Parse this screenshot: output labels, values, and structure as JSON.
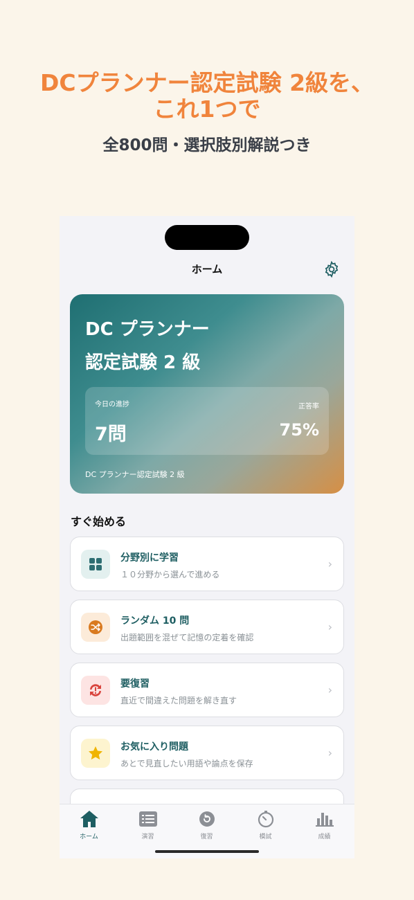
{
  "promo": {
    "headline_line1": "DCプランナー認定試験 2級を、",
    "headline_line2": "これ1つで",
    "subheadline": "全800問・選択肢別解説つき"
  },
  "nav": {
    "title": "ホーム",
    "settings_icon": "gear-icon"
  },
  "hero": {
    "title_line1": "DC プランナー",
    "title_line2": "認定試験 2 級",
    "progress_label": "今日の進捗",
    "progress_value": "7問",
    "accuracy_label": "正答率",
    "accuracy_value": "75%",
    "footer": "DC プランナー認定試験 2 級"
  },
  "section": {
    "title": "すぐ始める"
  },
  "cards": [
    {
      "title": "分野別に学習",
      "subtitle": "１０分野から選んで進める",
      "icon": "grid-icon",
      "icon_bg": "#e3f0ef",
      "icon_color": "#2e6e72"
    },
    {
      "title": "ランダム 10 問",
      "subtitle": "出題範囲を混ぜて記憶の定着を確認",
      "icon": "shuffle-icon",
      "icon_bg": "#fcebd9",
      "icon_color": "#d97a1f"
    },
    {
      "title": "要復習",
      "subtitle": "直近で間違えた問題を解き直す",
      "icon": "review-alert-icon",
      "icon_bg": "#fde4e3",
      "icon_color": "#d9443d"
    },
    {
      "title": "お気に入り問題",
      "subtitle": "あとで見直したい用語や論点を保存",
      "icon": "star-icon",
      "icon_bg": "#fdf4cf",
      "icon_color": "#f0b400"
    }
  ],
  "tabs": [
    {
      "label": "ホーム",
      "icon": "home-icon",
      "active": true
    },
    {
      "label": "演習",
      "icon": "list-icon",
      "active": false
    },
    {
      "label": "復習",
      "icon": "review-icon",
      "active": false
    },
    {
      "label": "模試",
      "icon": "timer-icon",
      "active": false
    },
    {
      "label": "成績",
      "icon": "bar-chart-icon",
      "active": false
    }
  ],
  "colors": {
    "accent": "#1e5e62",
    "promo_orange": "#f0843c",
    "background": "#fbf5ea"
  }
}
